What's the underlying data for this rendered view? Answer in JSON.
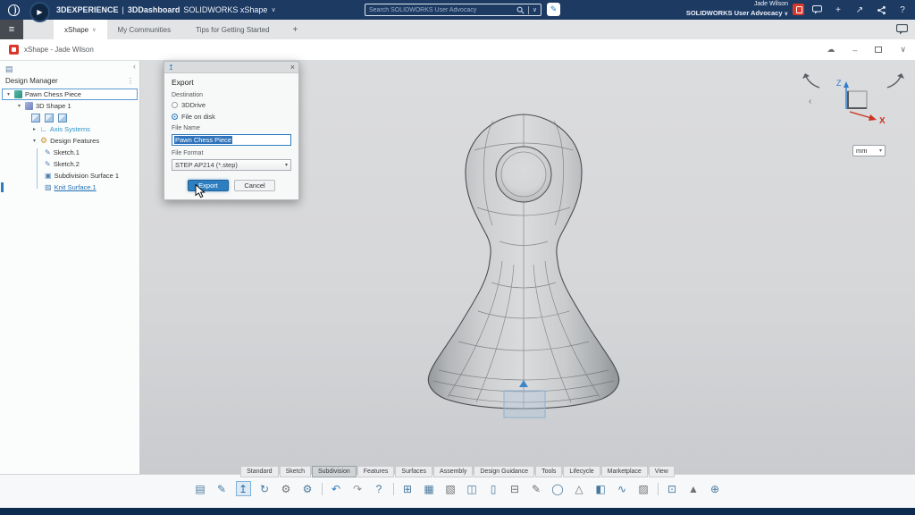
{
  "colors": {
    "accent_blue": "#2d7dc2",
    "topbar_navy": "#1d3a63",
    "selection_blue": "#5b9bd5",
    "axis_z_blue": "#2e7bd0",
    "axis_x_red": "#cc3322"
  },
  "topbar": {
    "brand": "3DEXPERIENCE",
    "divider": "|",
    "platform": "3DDashboard",
    "app": "SOLIDWORKS xShape",
    "app_chevron": "∨",
    "play_glyph": "▶",
    "search_placeholder": "Search SOLIDWORKS User Advocacy",
    "search_chevron": "∨",
    "pen_glyph": "✎",
    "user_name": "Jade Wilson",
    "user_org": "SOLIDWORKS User Advocacy",
    "org_chevron": "∨",
    "plus": "+",
    "share_arrow": "↗",
    "help": "?"
  },
  "tabbar": {
    "menu_glyph": "≡",
    "tabs": [
      {
        "label": "xShape",
        "chevron": "∨",
        "active": true
      },
      {
        "label": "My Communities"
      },
      {
        "label": "Tips for Getting Started"
      }
    ],
    "new_tab": "+"
  },
  "winbar": {
    "title": "xShape - Jade Wilson",
    "cloud": "☁",
    "minimize": "–",
    "chevron": "∨"
  },
  "panel": {
    "collapse": "‹",
    "tool_glyph": "▤",
    "title": "Design Manager",
    "kebab": "⋮",
    "tree": {
      "caret_open": "▾",
      "caret_closed": "▸",
      "root": "Pawn Chess Piece",
      "shape": "3D Shape 1",
      "axis_glyph": "∟",
      "axis": "Axis Systems",
      "gear": "⚙",
      "features_group": "Design Features",
      "features": [
        {
          "label": "Sketch.1",
          "glyph": "✎"
        },
        {
          "label": "Sketch.2",
          "glyph": "✎"
        },
        {
          "label": "Subdivision Surface 1",
          "glyph": "▣"
        },
        {
          "label": "Knit Surface.1",
          "glyph": "▨",
          "selected": true
        }
      ]
    }
  },
  "dialog": {
    "icon_glyph": "↥",
    "close": "×",
    "title": "Export",
    "destination_label": "Destination",
    "option_3ddrive": "3DDrive",
    "option_file": "File on disk",
    "file_name_label": "File Name",
    "file_name_value": "Pawn Chess Piece",
    "file_format_label": "File Format",
    "file_format_value": "STEP AP214 (*.step)",
    "export_btn": "Export",
    "cancel_btn": "Cancel"
  },
  "viewport": {
    "units": "mm",
    "units_chevron": "▾",
    "axis_z": "Z",
    "axis_x": "X",
    "nav_chevron": "‹"
  },
  "ribbon": {
    "tabs": [
      {
        "label": "Standard"
      },
      {
        "label": "Sketch"
      },
      {
        "label": "Subdivision",
        "active": true
      },
      {
        "label": "Features"
      },
      {
        "label": "Surfaces"
      },
      {
        "label": "Assembly"
      },
      {
        "label": "Design Guidance"
      },
      {
        "label": "Tools"
      },
      {
        "label": "Lifecycle"
      },
      {
        "label": "Marketplace"
      },
      {
        "label": "View"
      }
    ],
    "icons": [
      {
        "name": "clipboard-icon",
        "glyph": "▤",
        "color": "#47799f"
      },
      {
        "name": "sheet-edit-icon",
        "glyph": "✎",
        "color": "#47799f"
      },
      {
        "name": "export-tool-icon",
        "glyph": "↥",
        "color": "#2d6da3",
        "active": true
      },
      {
        "name": "sync-icon",
        "glyph": "↻",
        "color": "#47799f"
      },
      {
        "name": "gear-icon",
        "glyph": "⚙",
        "color": "#6d7174"
      },
      {
        "name": "gear-tools-icon",
        "glyph": "⚙",
        "color": "#47799f"
      },
      {
        "sep": true
      },
      {
        "name": "undo-icon",
        "glyph": "↶",
        "color": "#2f7cc0"
      },
      {
        "name": "redo-icon",
        "glyph": "↷",
        "color": "#8d9093"
      },
      {
        "name": "help-icon",
        "glyph": "?",
        "color": "#47799f"
      },
      {
        "sep": true
      },
      {
        "name": "keyboard-icon",
        "glyph": "⊞",
        "color": "#47799f"
      },
      {
        "name": "grid-icon",
        "glyph": "▦",
        "color": "#47799f"
      },
      {
        "name": "grid-edit-icon",
        "glyph": "▧",
        "color": "#6d7174"
      },
      {
        "name": "frame-icon",
        "glyph": "◫",
        "color": "#47799f"
      },
      {
        "name": "document-icon",
        "glyph": "▯",
        "color": "#47799f"
      },
      {
        "name": "table-icon",
        "glyph": "⊟",
        "color": "#6d7174"
      },
      {
        "name": "pencil-icon",
        "glyph": "✎",
        "color": "#6d7174"
      },
      {
        "name": "sphere-icon",
        "glyph": "◯",
        "color": "#47799f"
      },
      {
        "name": "cone-icon",
        "glyph": "△",
        "color": "#6d7174"
      },
      {
        "name": "half-square-icon",
        "glyph": "◧",
        "color": "#47799f"
      },
      {
        "name": "spline-icon",
        "glyph": "∿",
        "color": "#47799f"
      },
      {
        "name": "patch-icon",
        "glyph": "▨",
        "color": "#6d7174"
      },
      {
        "sep": true
      },
      {
        "name": "sheet-stack-icon",
        "glyph": "⊡",
        "color": "#47799f"
      },
      {
        "name": "pyramid-icon",
        "glyph": "▲",
        "color": "#6d7174"
      },
      {
        "name": "globe-icon",
        "glyph": "⊕",
        "color": "#47799f"
      }
    ]
  }
}
